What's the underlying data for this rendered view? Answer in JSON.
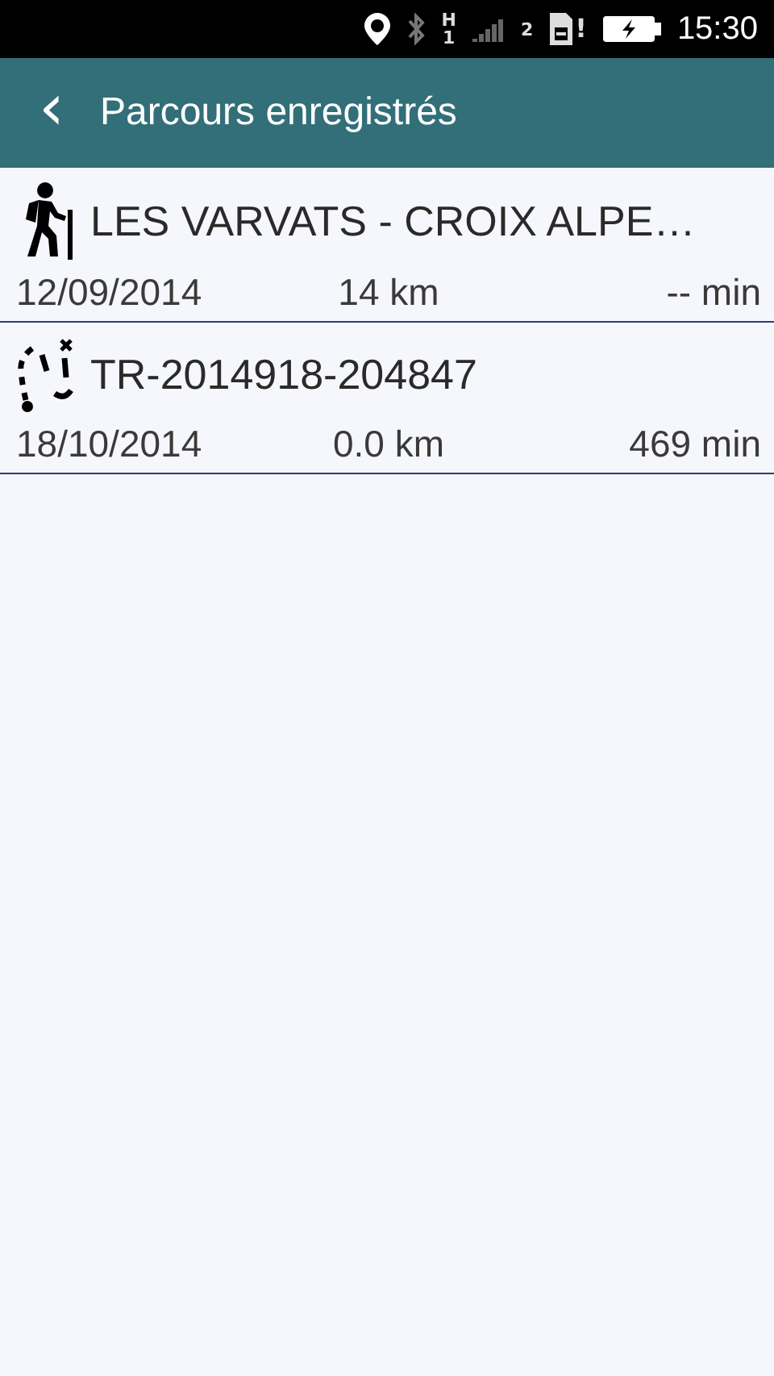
{
  "status_bar": {
    "network_type": "H",
    "sim_slot": "1",
    "sim2_label": "2",
    "sim2_alert": "!",
    "time": "15:30"
  },
  "app_bar": {
    "back": "‹",
    "title": "Parcours enregistrés"
  },
  "tracks": [
    {
      "kind": "hike",
      "name": "LES VARVATS - CROIX ALPE…",
      "date": "12/09/2014",
      "distance": "14 km",
      "duration": "-- min"
    },
    {
      "kind": "recorded",
      "name": "TR-2014918-204847",
      "date": "18/10/2014",
      "distance": "0.0 km",
      "duration": "469 min"
    }
  ]
}
